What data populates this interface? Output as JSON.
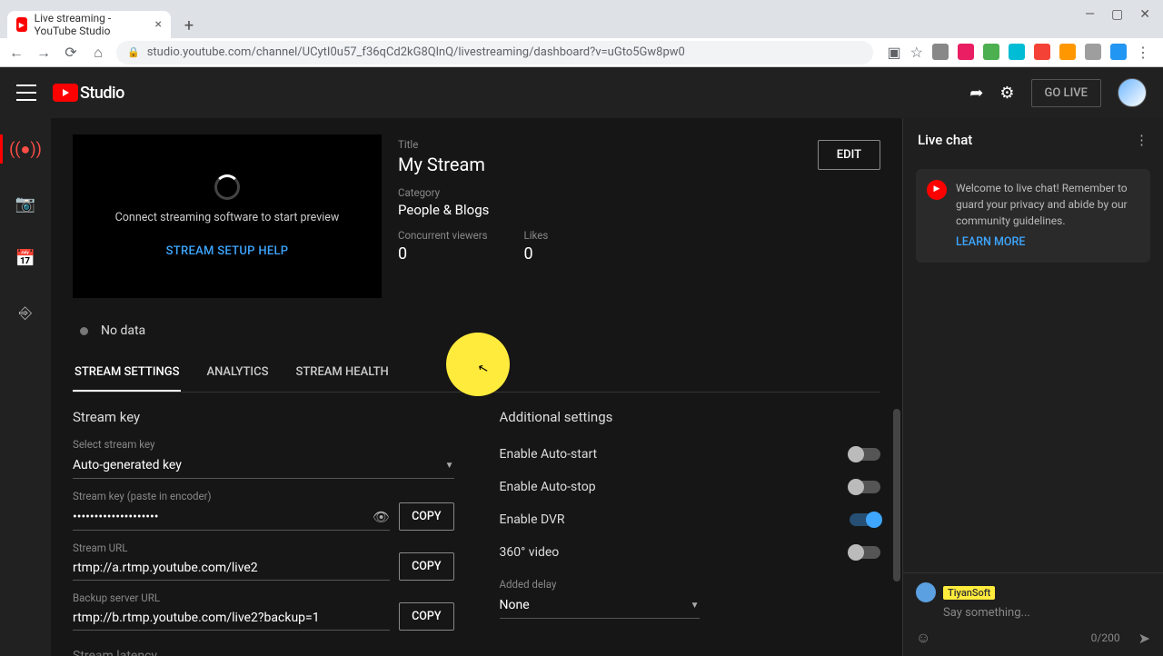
{
  "browser": {
    "tab_title": "Live streaming - YouTube Studio",
    "url": "studio.youtube.com/channel/UCytI0u57_f36qCd2kG8QlnQ/livestreaming/dashboard?v=uGto5Gw8pw0"
  },
  "header": {
    "brand": "Studio",
    "go_live": "GO LIVE"
  },
  "preview": {
    "message": "Connect streaming software to start preview",
    "help_link": "STREAM SETUP HELP"
  },
  "stream": {
    "title_label": "Title",
    "title": "My Stream",
    "category_label": "Category",
    "category": "People & Blogs",
    "viewers_label": "Concurrent viewers",
    "viewers": "0",
    "likes_label": "Likes",
    "likes": "0",
    "edit": "EDIT"
  },
  "status": {
    "text": "No data"
  },
  "tabs": {
    "settings": "STREAM SETTINGS",
    "analytics": "ANALYTICS",
    "health": "STREAM HEALTH"
  },
  "stream_key": {
    "section": "Stream key",
    "select_label": "Select stream key",
    "select_value": "Auto-generated key",
    "key_label": "Stream key (paste in encoder)",
    "key_value": "••••••••••••••••••••",
    "url_label": "Stream URL",
    "url_value": "rtmp://a.rtmp.youtube.com/live2",
    "backup_label": "Backup server URL",
    "backup_value": "rtmp://b.rtmp.youtube.com/live2?backup=1",
    "latency_section": "Stream latency",
    "copy": "COPY"
  },
  "additional": {
    "section": "Additional settings",
    "auto_start": "Enable Auto-start",
    "auto_stop": "Enable Auto-stop",
    "dvr": "Enable DVR",
    "video360": "360° video",
    "delay_label": "Added delay",
    "delay_value": "None"
  },
  "chat": {
    "title": "Live chat",
    "welcome": "Welcome to live chat! Remember to guard your privacy and abide by our community guidelines.",
    "learn_more": "LEARN MORE",
    "username": "TiyanSoft",
    "placeholder": "Say something...",
    "counter": "0/200"
  }
}
